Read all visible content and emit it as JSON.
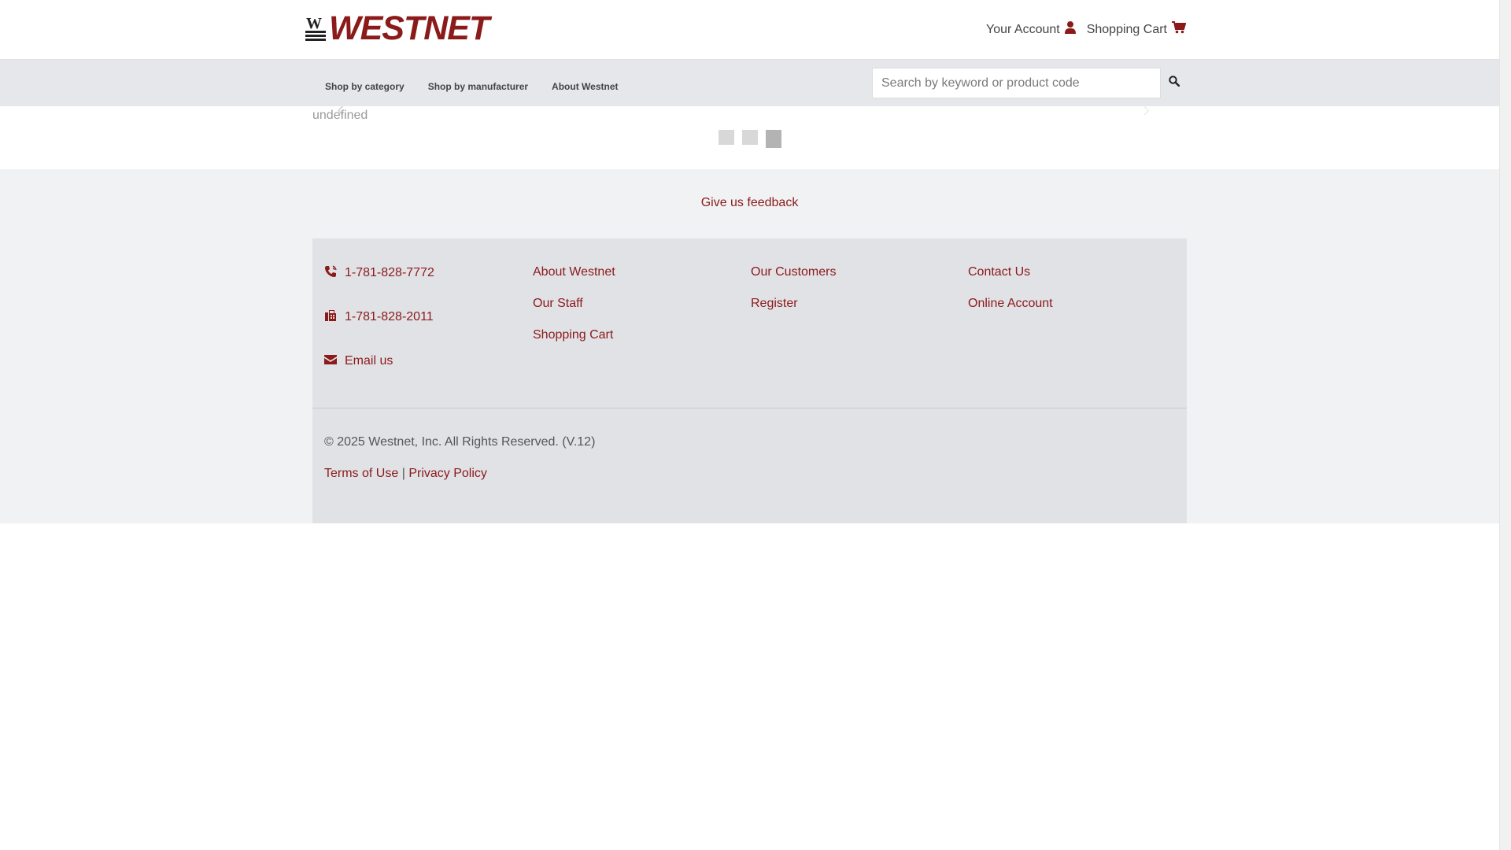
{
  "brand": {
    "logo_text": "WESTNET",
    "logo_mark_text": "W",
    "accent_color": "#8b1a1a"
  },
  "header": {
    "account_label": "Your Account",
    "cart_label": "Shopping Cart"
  },
  "nav": {
    "items": [
      {
        "label": "Shop by category"
      },
      {
        "label": "Shop by manufacturer"
      },
      {
        "label": "About Westnet"
      }
    ]
  },
  "search": {
    "placeholder": "Search by keyword or product code",
    "value": ""
  },
  "slider": {
    "caption": "undefined",
    "prev_arrow": "‹",
    "next_arrow": "›",
    "dots_count": 3,
    "active_dot": 3
  },
  "footer": {
    "feedback_label": "Give us feedback",
    "phone": "1-781-828-7772",
    "fax": "1-781-828-2011",
    "email_label": "Email us",
    "links_col1": [
      "About Westnet",
      "Our Staff",
      "Shopping Cart"
    ],
    "links_col2": [
      "Our Customers",
      "Register"
    ],
    "links_col3": [
      "Contact Us",
      "Online Account"
    ],
    "copyright": "© 2025 Westnet, Inc. All Rights Reserved. (V.12)",
    "terms_label": "Terms of Use",
    "separator": "|",
    "privacy_label": "Privacy Policy"
  },
  "icons": {
    "account": "user-icon",
    "cart": "cart-icon",
    "search": "search-icon",
    "phone": "phone-icon",
    "fax": "fax-icon",
    "email": "envelope-icon"
  }
}
